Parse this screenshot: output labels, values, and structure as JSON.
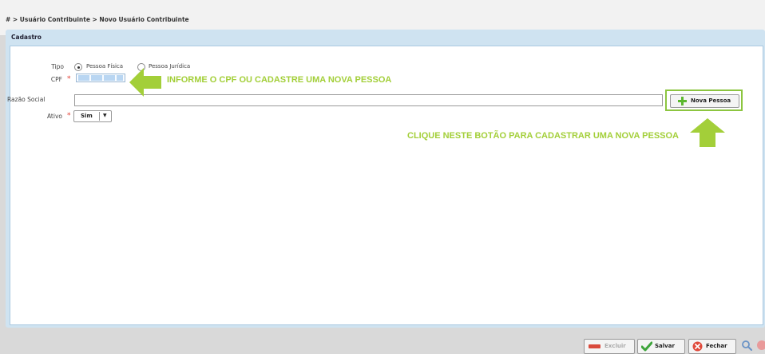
{
  "breadcrumb": "# > Usuário Contribuinte > Novo Usuário Contribuinte",
  "panel": {
    "title": "Cadastro"
  },
  "form": {
    "tipo_label": "Tipo",
    "tipo_options": [
      "Pessoa Física",
      "Pessoa Jurídica"
    ],
    "tipo_selected": "Pessoa Física",
    "cpf_label": "CPF",
    "razao_label": "Razão Social",
    "ativo_label": "Ativo",
    "ativo_value": "Sim",
    "required_mark": "*"
  },
  "buttons": {
    "nova_pessoa": "Nova Pessoa",
    "excluir": "Excluir",
    "salvar": "Salvar",
    "fechar": "Fechar"
  },
  "annotations": {
    "cpf_hint": "INFORME O CPF OU CADASTRE UMA NOVA PESSOA",
    "button_hint": "CLIQUE NESTE BOTÃO PARA CADASTRAR UMA NOVA PESSOA"
  },
  "colors": {
    "annotation": "#a3cf39",
    "required": "#e23a2f",
    "panel": "#cfe3f1"
  },
  "icons": [
    "plus-icon",
    "arrow-left-icon",
    "arrow-up-icon",
    "minus-icon",
    "check-icon",
    "close-icon",
    "search-icon"
  ]
}
